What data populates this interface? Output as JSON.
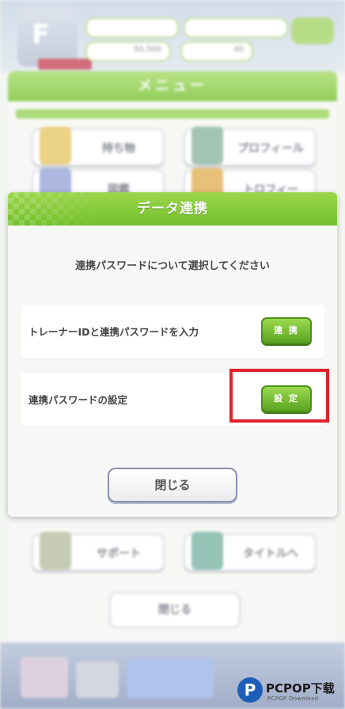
{
  "background": {
    "rank_letter": "F",
    "stats": [
      "50,500",
      "40"
    ],
    "menu_title": "メニュー",
    "menu_buttons": [
      "持ち物",
      "プロフィール",
      "図鑑",
      "トロフィー",
      "サポート",
      "タイトルへ"
    ],
    "close_label": "閉じる"
  },
  "dialog": {
    "title": "データ連携",
    "prompt": "連携パスワードについて選択してください",
    "options": [
      {
        "label": "トレーナーIDと連携パスワードを入力",
        "button": "連 携"
      },
      {
        "label": "連携パスワードの設定",
        "button": "設 定"
      }
    ],
    "close_label": "閉じる"
  },
  "watermark": {
    "logo": "P",
    "text": "PCPOP下载",
    "sub": "PCPOP Download"
  },
  "colors": {
    "accent_green": "#74c02b",
    "highlight_red": "#e0202a"
  }
}
